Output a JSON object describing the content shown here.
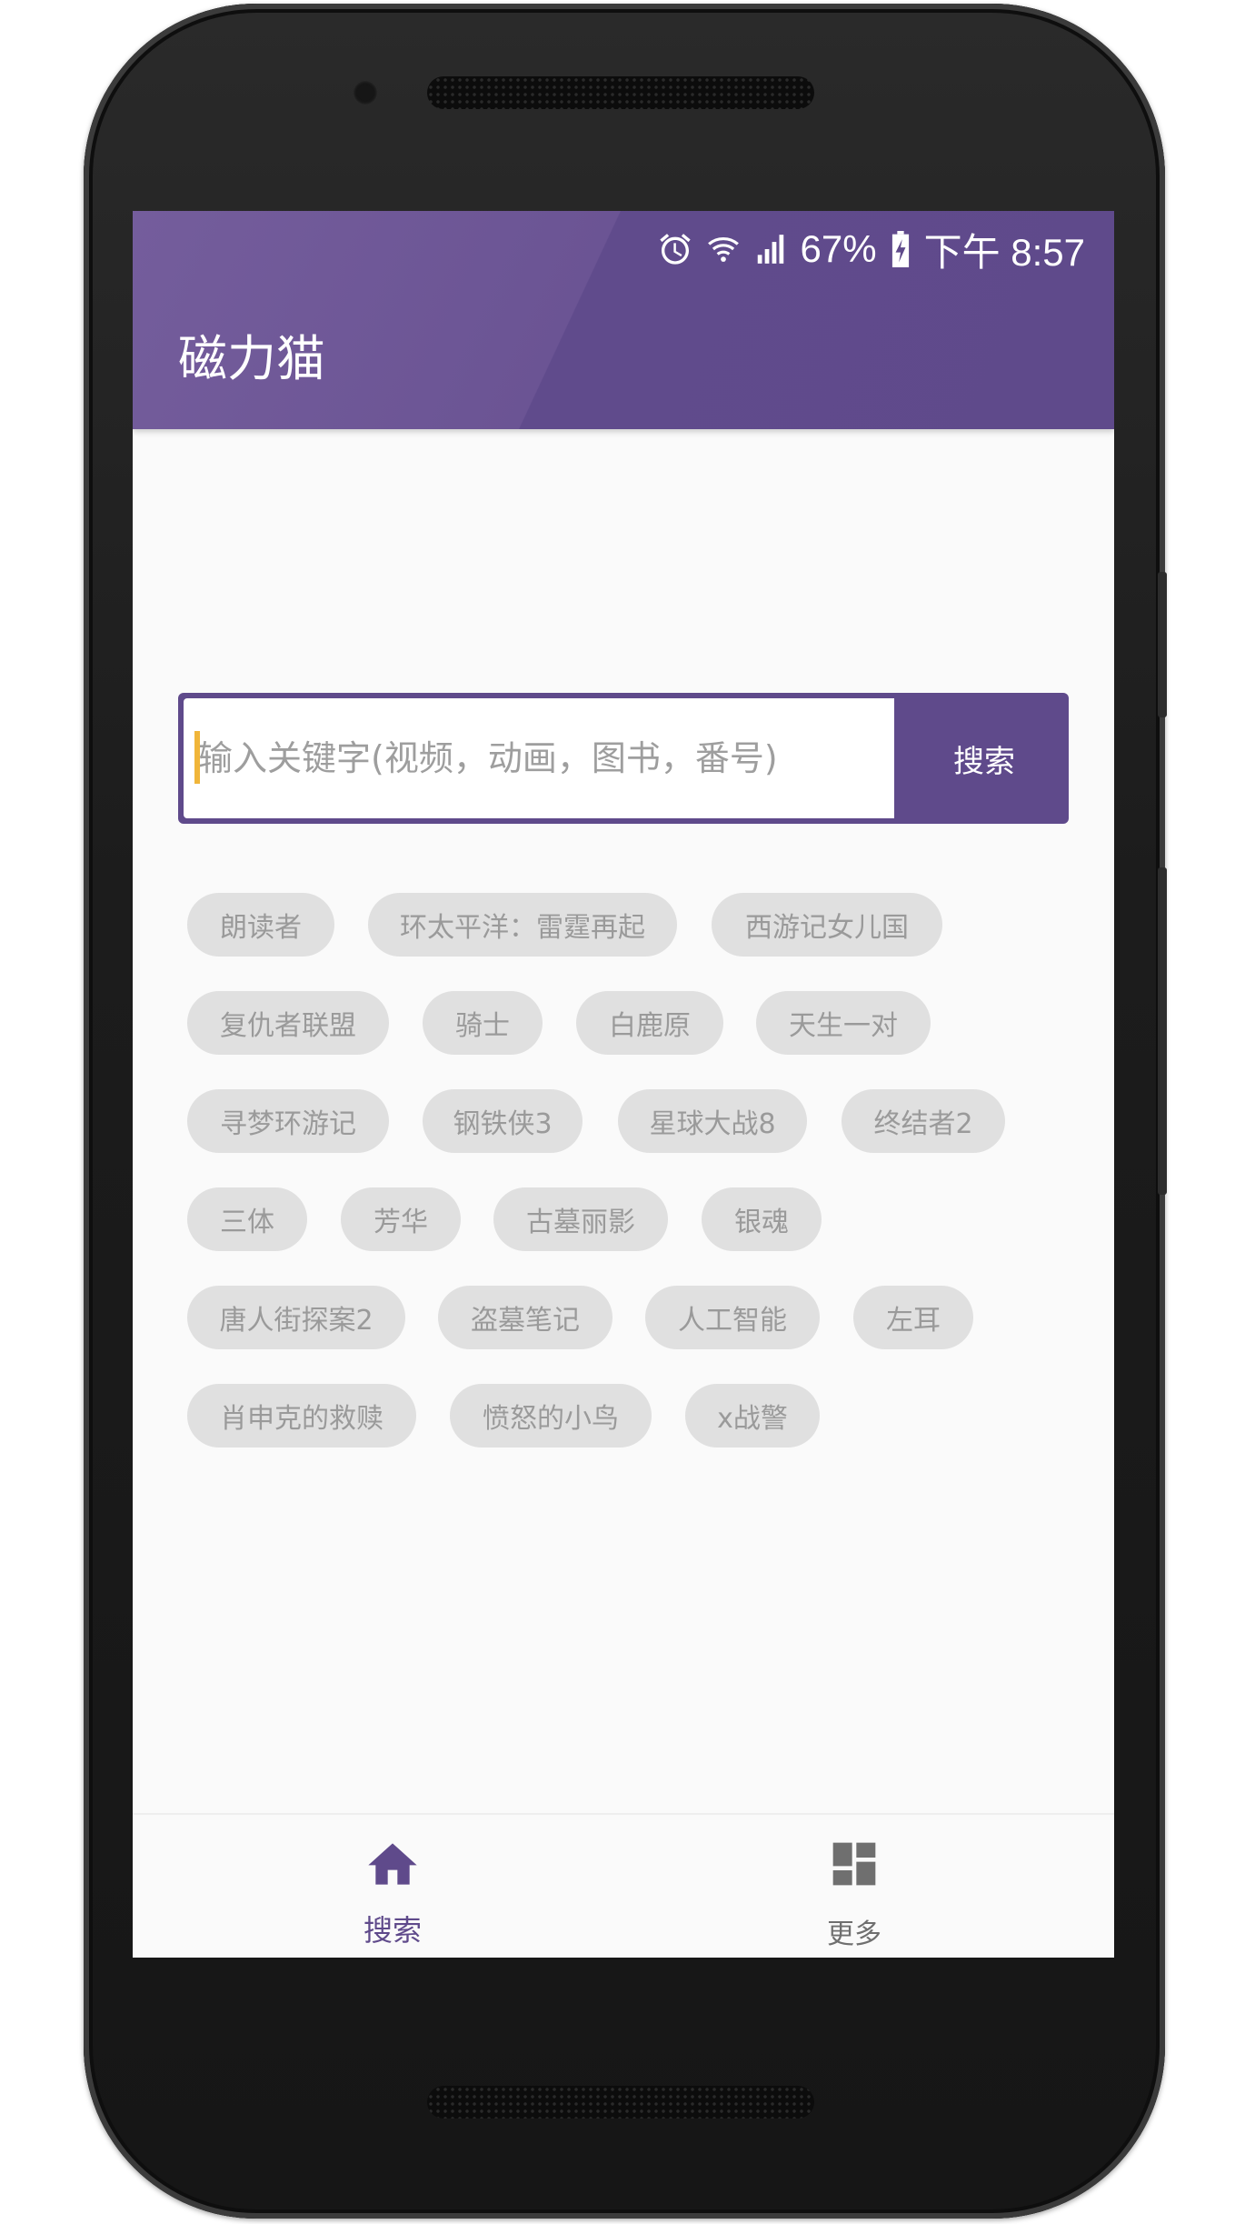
{
  "status_bar": {
    "battery_text": "67%",
    "time_text": "下午 8:57",
    "icons": [
      "alarm-icon",
      "wifi-icon",
      "signal-icon",
      "battery-charging-icon"
    ]
  },
  "app_bar": {
    "title": "磁力猫"
  },
  "search": {
    "placeholder": "输入关键字(视频，动画，图书，番号)",
    "button_label": "搜索"
  },
  "hot_keywords": [
    "朗读者",
    "环太平洋：雷霆再起",
    "西游记女儿国",
    "复仇者联盟",
    "骑士",
    "白鹿原",
    "天生一对",
    "寻梦环游记",
    "钢铁侠3",
    "星球大战8",
    "终结者2",
    "三体",
    "芳华",
    "古墓丽影",
    "银魂",
    "唐人街探案2",
    "盗墓笔记",
    "人工智能",
    "左耳",
    "肖申克的救赎",
    "愤怒的小鸟",
    "x战警"
  ],
  "bottom_nav": {
    "items": [
      {
        "label": "搜索",
        "icon": "home-icon",
        "active": true
      },
      {
        "label": "更多",
        "icon": "dashboard-icon",
        "active": false
      }
    ]
  },
  "colors": {
    "primary": "#5f4a8b",
    "chip_bg": "#e0e0e0",
    "chip_text": "#9a9a9a",
    "inactive_nav": "#6f6f6f",
    "accent_caret": "#f0b53a"
  }
}
